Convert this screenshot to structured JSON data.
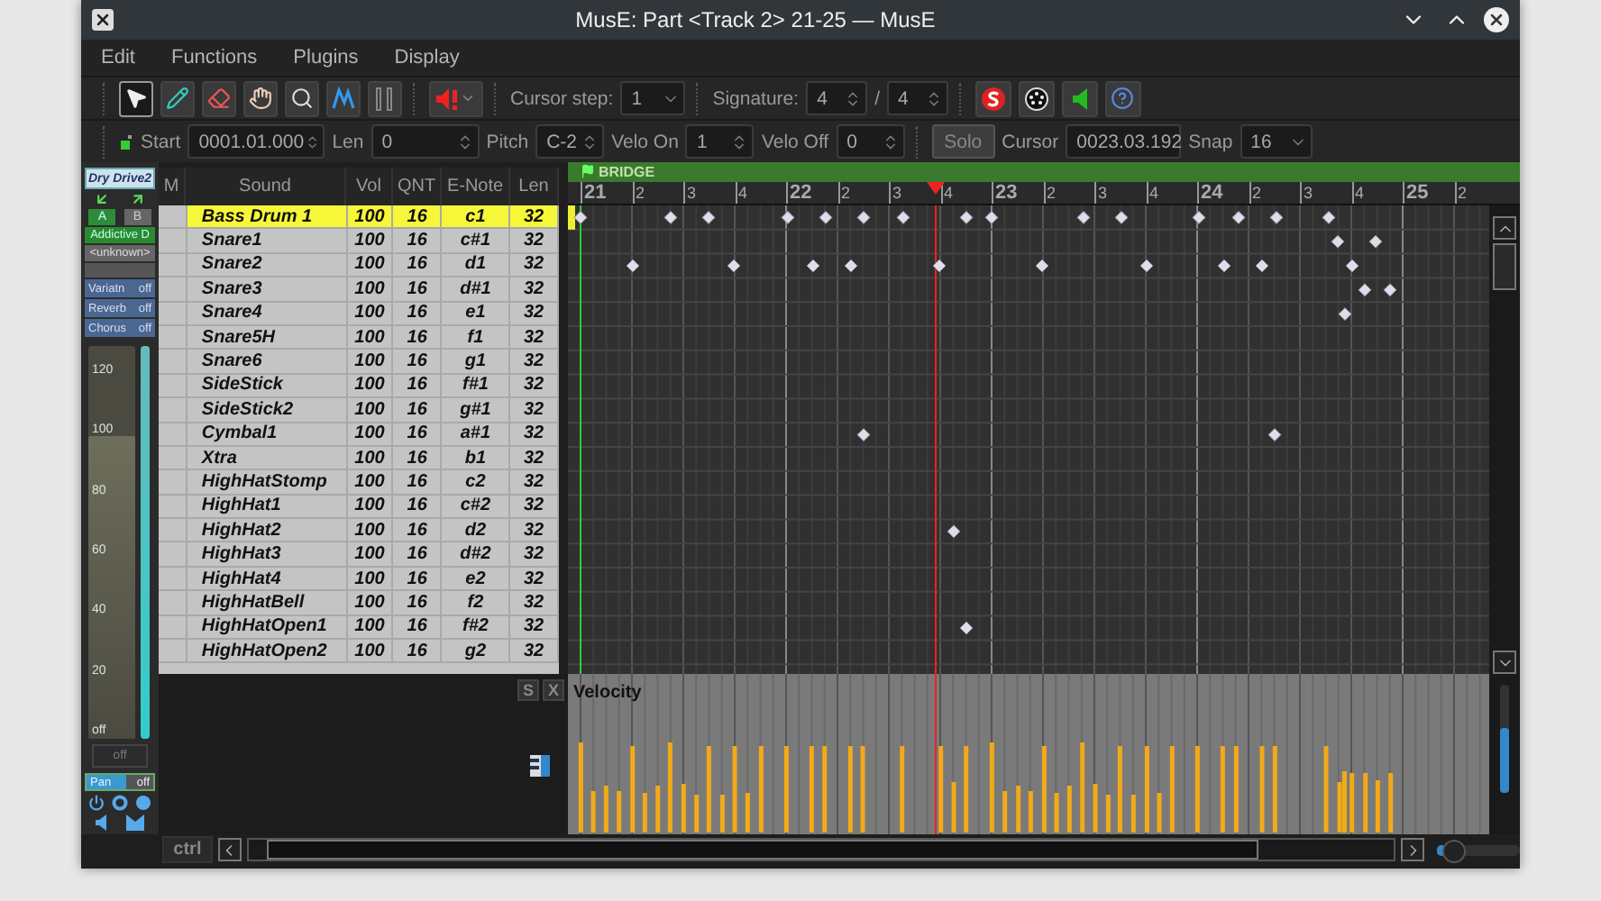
{
  "window": {
    "title": "MusE: Part <Track 2> 21-25 — MusE"
  },
  "menu": [
    "Edit",
    "Functions",
    "Plugins",
    "Display"
  ],
  "tools": [
    {
      "kind": "pointer",
      "selected": true
    },
    {
      "kind": "pencil",
      "selected": false
    },
    {
      "kind": "eraser",
      "selected": false
    },
    {
      "kind": "hand",
      "selected": false
    },
    {
      "kind": "zoom",
      "selected": false
    },
    {
      "kind": "line",
      "selected": false
    },
    {
      "kind": "cursor",
      "selected": false
    }
  ],
  "cursor_step": {
    "label": "Cursor step:",
    "value": "1"
  },
  "signature": {
    "label": "Signature:",
    "numerator": "4",
    "separator": "/",
    "denominator": "4"
  },
  "event_fields": [
    {
      "label": "Start",
      "value": "0001.01.000"
    },
    {
      "label": "Len",
      "value": "0"
    },
    {
      "label": "Pitch",
      "value": "C-2"
    },
    {
      "label": "Velo On",
      "value": "1"
    },
    {
      "label": "Velo Off",
      "value": "0"
    }
  ],
  "solo": "Solo",
  "cursor": {
    "label": "Cursor",
    "value": "0023.03.192"
  },
  "snap": {
    "label": "Snap",
    "value": "16"
  },
  "strip": {
    "name": "Dry Drive2",
    "routes": [
      {
        "label": "A",
        "selected": true
      },
      {
        "label": "B",
        "selected": false
      }
    ],
    "instrument": "Addictive D",
    "patch": "<unknown>",
    "controls": [
      {
        "label": "Variatn",
        "value": "off"
      },
      {
        "label": "Reverb",
        "value": "off"
      },
      {
        "label": "Chorus",
        "value": "off"
      }
    ],
    "fader": {
      "level": 0.77,
      "scale": [
        "120",
        "100",
        "80",
        "60",
        "40",
        "20",
        "off"
      ]
    },
    "readout": "off",
    "pan": {
      "label": "Pan",
      "value": "off"
    }
  },
  "drum_list": {
    "columns": [
      "M",
      "Sound",
      "Vol",
      "QNT",
      "E-Note",
      "Len"
    ],
    "rows": [
      {
        "sound": "Bass Drum 1",
        "vol": "100",
        "qnt": "16",
        "note": "c1",
        "len": "32",
        "selected": true
      },
      {
        "sound": "Snare1",
        "vol": "100",
        "qnt": "16",
        "note": "c#1",
        "len": "32",
        "selected": false
      },
      {
        "sound": "Snare2",
        "vol": "100",
        "qnt": "16",
        "note": "d1",
        "len": "32",
        "selected": false
      },
      {
        "sound": "Snare3",
        "vol": "100",
        "qnt": "16",
        "note": "d#1",
        "len": "32",
        "selected": false
      },
      {
        "sound": "Snare4",
        "vol": "100",
        "qnt": "16",
        "note": "e1",
        "len": "32",
        "selected": false
      },
      {
        "sound": "Snare5H",
        "vol": "100",
        "qnt": "16",
        "note": "f1",
        "len": "32",
        "selected": false
      },
      {
        "sound": "Snare6",
        "vol": "100",
        "qnt": "16",
        "note": "g1",
        "len": "32",
        "selected": false
      },
      {
        "sound": "SideStick",
        "vol": "100",
        "qnt": "16",
        "note": "f#1",
        "len": "32",
        "selected": false
      },
      {
        "sound": "SideStick2",
        "vol": "100",
        "qnt": "16",
        "note": "g#1",
        "len": "32",
        "selected": false
      },
      {
        "sound": "Cymbal1",
        "vol": "100",
        "qnt": "16",
        "note": "a#1",
        "len": "32",
        "selected": false
      },
      {
        "sound": "Xtra",
        "vol": "100",
        "qnt": "16",
        "note": "b1",
        "len": "32",
        "selected": false
      },
      {
        "sound": "HighHatStomp",
        "vol": "100",
        "qnt": "16",
        "note": "c2",
        "len": "32",
        "selected": false
      },
      {
        "sound": "HighHat1",
        "vol": "100",
        "qnt": "16",
        "note": "c#2",
        "len": "32",
        "selected": false
      },
      {
        "sound": "HighHat2",
        "vol": "100",
        "qnt": "16",
        "note": "d2",
        "len": "32",
        "selected": false
      },
      {
        "sound": "HighHat3",
        "vol": "100",
        "qnt": "16",
        "note": "d#2",
        "len": "32",
        "selected": false
      },
      {
        "sound": "HighHat4",
        "vol": "100",
        "qnt": "16",
        "note": "e2",
        "len": "32",
        "selected": false
      },
      {
        "sound": "HighHatBell",
        "vol": "100",
        "qnt": "16",
        "note": "f2",
        "len": "32",
        "selected": false
      },
      {
        "sound": "HighHatOpen1",
        "vol": "100",
        "qnt": "16",
        "note": "f#2",
        "len": "32",
        "selected": false
      },
      {
        "sound": "HighHatOpen2",
        "vol": "100",
        "qnt": "16",
        "note": "g2",
        "len": "32",
        "selected": false
      }
    ]
  },
  "marker": "BRIDGE",
  "ruler": [
    {
      "label": "21",
      "kind": "bar"
    },
    {
      "label": "2",
      "kind": "beat"
    },
    {
      "label": "3",
      "kind": "beat"
    },
    {
      "label": "4",
      "kind": "beat"
    },
    {
      "label": "22",
      "kind": "bar"
    },
    {
      "label": "2",
      "kind": "beat"
    },
    {
      "label": "3",
      "kind": "beat"
    },
    {
      "label": "4",
      "kind": "beat"
    },
    {
      "label": "23",
      "kind": "bar"
    },
    {
      "label": "2",
      "kind": "beat"
    },
    {
      "label": "3",
      "kind": "beat"
    },
    {
      "label": "4",
      "kind": "beat"
    },
    {
      "label": "24",
      "kind": "bar"
    },
    {
      "label": "2",
      "kind": "beat"
    },
    {
      "label": "3",
      "kind": "beat"
    },
    {
      "label": "4",
      "kind": "beat"
    },
    {
      "label": "25",
      "kind": "bar"
    },
    {
      "label": "2",
      "kind": "beat"
    }
  ],
  "controller": {
    "label": "Velocity",
    "buttons": [
      "S",
      "X"
    ]
  },
  "ctrl_button": "ctrl",
  "vertical_zoom": {
    "level": 0.6
  },
  "horizontal_zoom": {
    "level": 0.1
  }
}
